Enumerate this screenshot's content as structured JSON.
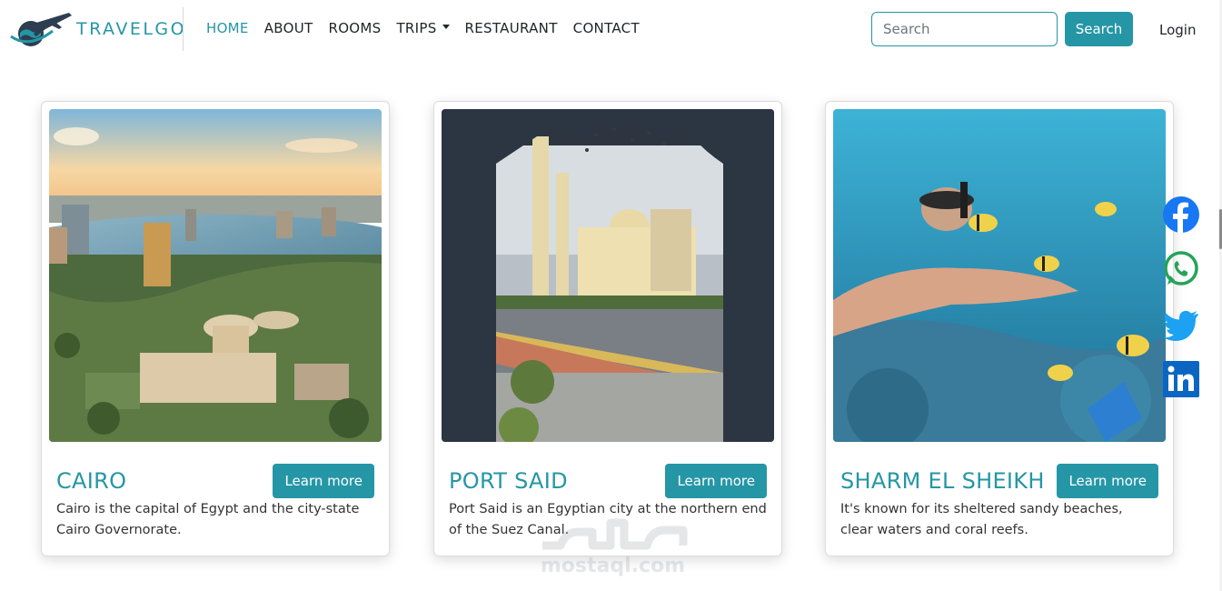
{
  "brand": {
    "name": "TRAVELGO",
    "logo_icon": "plane-globe-icon"
  },
  "nav": {
    "items": [
      {
        "label": "HOME",
        "active": true
      },
      {
        "label": "ABOUT",
        "active": false
      },
      {
        "label": "ROOMS",
        "active": false
      },
      {
        "label": "TRIPS",
        "active": false,
        "dropdown": true
      },
      {
        "label": "RESTAURANT",
        "active": false
      },
      {
        "label": "CONTACT",
        "active": false
      }
    ]
  },
  "search": {
    "placeholder": "Search",
    "value": "",
    "button_label": "Search"
  },
  "login_label": "Login",
  "cards": [
    {
      "title": "CAIRO",
      "button_label": "Learn more",
      "text": "Cairo is the capital of Egypt and the city-state Cairo Governorate.",
      "image": "cairo-nile-city-photo"
    },
    {
      "title": "PORT SAID",
      "button_label": "Learn more",
      "text": "Port Said is an Egyptian city at the northern end of the Suez Canal.",
      "image": "port-said-mosque-arch-photo"
    },
    {
      "title": "SHARM EL SHEIKH",
      "button_label": "Learn more",
      "text": "It's known for its sheltered sandy beaches, clear waters and coral reefs.",
      "image": "sharm-el-sheikh-snorkel-photo"
    }
  ],
  "social": [
    "facebook-icon",
    "whatsapp-icon",
    "twitter-icon",
    "linkedin-icon"
  ],
  "colors": {
    "accent": "#2596a6",
    "facebook": "#1877f2",
    "whatsapp": "#25a35a",
    "twitter": "#1da1f2",
    "linkedin": "#0a66c2"
  },
  "watermark": {
    "arabic": "مستقل",
    "latin": "mostaql.com"
  }
}
